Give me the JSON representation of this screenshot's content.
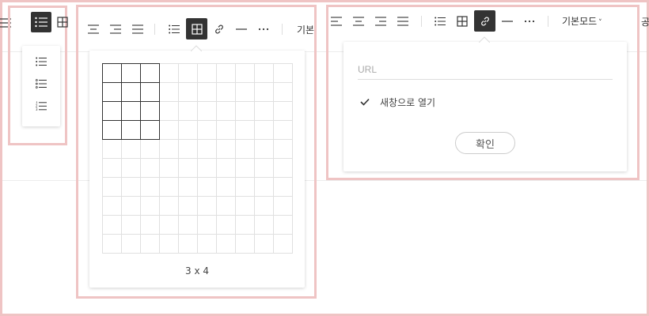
{
  "toolbar1": {
    "bullet_list_icon": "bullet-list-icon",
    "table_icon": "table-icon",
    "align_icon": "align-justify-icon"
  },
  "list_dropdown": {
    "items": [
      {
        "icon": "bullet-list-icon"
      },
      {
        "icon": "circle-list-icon"
      },
      {
        "icon": "numbered-list-icon"
      }
    ]
  },
  "toolbar2": {
    "mode_label": "기본"
  },
  "table_picker": {
    "rows": 10,
    "cols": 10,
    "selected_cols": 3,
    "selected_rows": 4,
    "size_label": "3 x 4"
  },
  "toolbar3": {
    "mode_label": "기본모드",
    "mode_chevron": "˅",
    "cutoff_text": "공"
  },
  "link_popup": {
    "url_placeholder": "URL",
    "url_value": "",
    "new_window_label": "새창으로 열기",
    "new_window_checked": true,
    "confirm_label": "확인"
  },
  "colors": {
    "frame": "#efc4c4",
    "active_button_bg": "#333333"
  }
}
